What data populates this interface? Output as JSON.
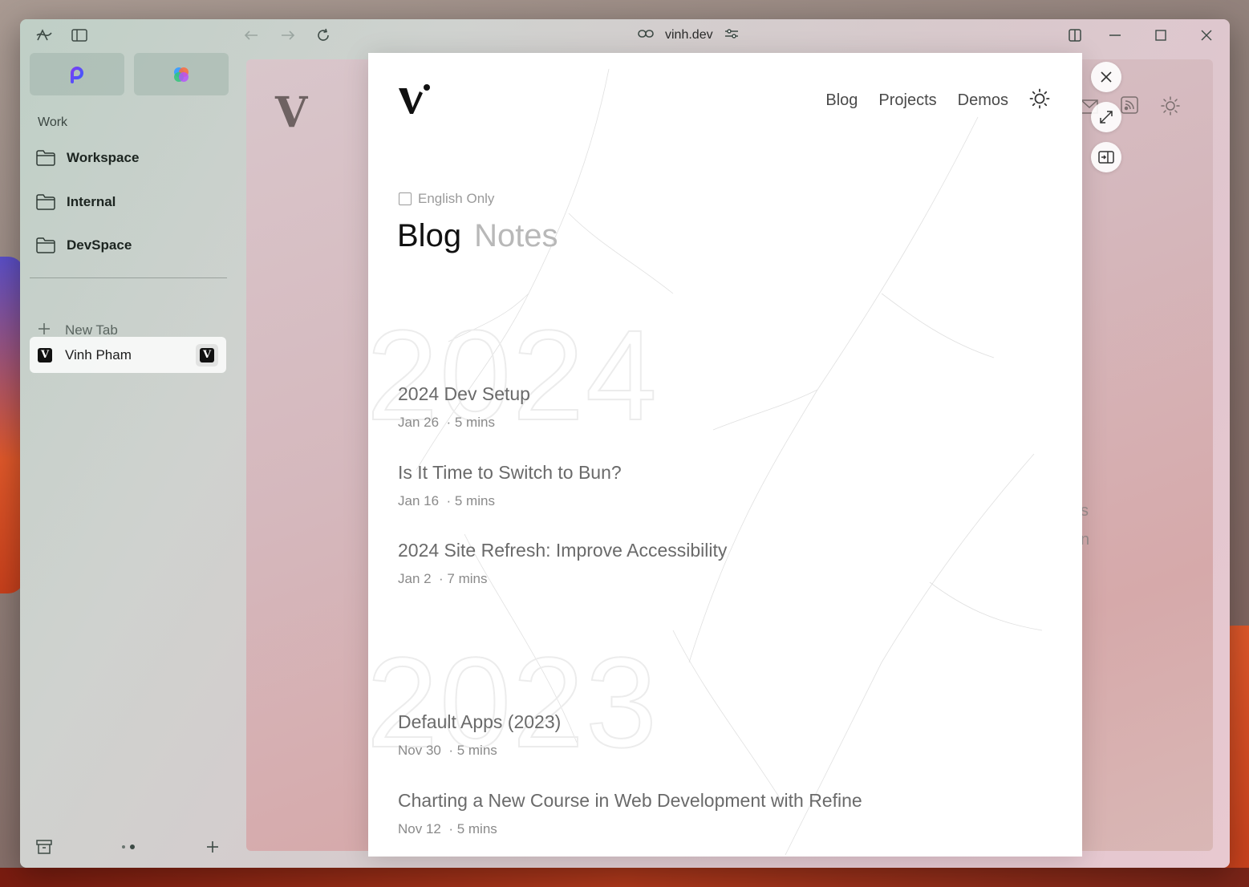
{
  "browser": {
    "url": "vinh.dev",
    "space_label": "Work",
    "folders": [
      {
        "label": "Workspace"
      },
      {
        "label": "Internal"
      },
      {
        "label": "DevSpace"
      }
    ],
    "new_tab_label": "New Tab",
    "active_tab": {
      "title": "Vinh Pham"
    }
  },
  "site": {
    "nav": {
      "blog": "Blog",
      "projects": "Projects",
      "demos": "Demos"
    },
    "filter_label": "English Only",
    "heading_primary": "Blog",
    "heading_secondary": "Notes",
    "years": [
      "2024",
      "2023"
    ],
    "posts": [
      {
        "title": "2024 Dev Setup",
        "date": "Jan 26",
        "duration": "· 5 mins"
      },
      {
        "title": "Is It Time to Switch to Bun?",
        "date": "Jan 16",
        "duration": "· 5 mins"
      },
      {
        "title": "2024 Site Refresh: Improve Accessibility",
        "date": "Jan 2",
        "duration": "· 7 mins"
      },
      {
        "title": "Default Apps (2023)",
        "date": "Nov 30",
        "duration": "· 5 mins"
      },
      {
        "title": "Charting a New Course in Web Development with Refine",
        "date": "Nov 12",
        "duration": "· 5 mins"
      }
    ]
  },
  "background_page": {
    "fragments": [
      "s",
      "n"
    ]
  },
  "colors": {
    "accent": "#111111",
    "muted": "#8a8a8a"
  }
}
